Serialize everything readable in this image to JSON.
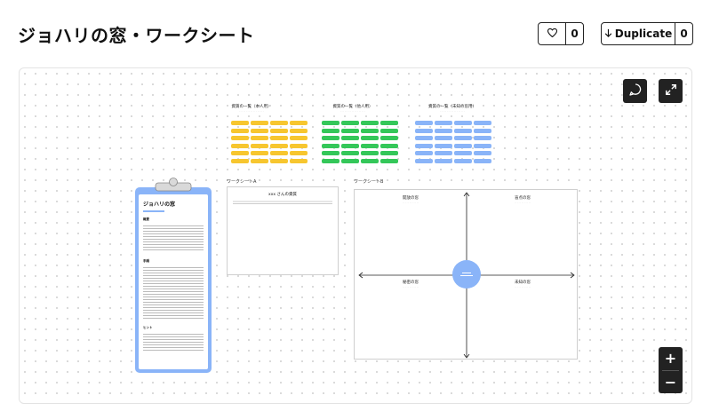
{
  "page": {
    "title": "ジョハリの窓・ワークシート"
  },
  "actions": {
    "like_count": "0",
    "duplicate_label": "Duplicate",
    "duplicate_count": "0"
  },
  "board": {
    "lists": [
      {
        "title": "資質の一覧（本人用）",
        "color": "#f7c62f"
      },
      {
        "title": "資質の一覧（他人用）",
        "color": "#34c759"
      },
      {
        "title": "資質の一覧（未知の窓用）",
        "color": "#8ab4f8"
      }
    ],
    "worksheet_a": {
      "label": "ワークシートA",
      "card_title": "xxx さんの資質"
    },
    "worksheet_b": {
      "label": "ワークシートB",
      "quadrants": [
        "開放の窓",
        "盲点の窓",
        "秘密の窓",
        "未知の窓"
      ]
    },
    "clipboard": {
      "title": "ジョハリの窓",
      "sections": [
        "概要",
        "手順",
        "ヒント"
      ]
    }
  },
  "colors": {
    "accent_blue": "#8ab4f8",
    "dark": "#222222"
  },
  "icons": [
    "heart-icon",
    "arrow-down-icon",
    "comment-icon",
    "expand-icon",
    "plus-icon",
    "minus-icon"
  ]
}
